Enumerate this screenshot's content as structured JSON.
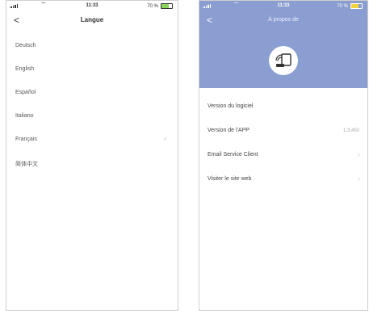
{
  "left_screen": {
    "status": {
      "time": "11:33",
      "battery": "70 %"
    },
    "nav": {
      "back": "<",
      "title": "Langue"
    },
    "languages": [
      "Deutsch",
      "English",
      "Español",
      "Italiano",
      "Français",
      "简体中文"
    ],
    "selected_mark": "✓"
  },
  "right_screen": {
    "status": {
      "time": "11:33",
      "battery": "70 %"
    },
    "nav": {
      "back": "<",
      "title": "À propos de"
    },
    "header_color": "#8b9ed1",
    "items": [
      {
        "label": "Version du logiciel",
        "value": ""
      },
      {
        "label": "Version de l'APP",
        "value": "1.3.450"
      },
      {
        "label": "Email Service Client",
        "value": ""
      },
      {
        "label": "Visiter le site web",
        "value": ""
      }
    ],
    "arrow": "›"
  }
}
